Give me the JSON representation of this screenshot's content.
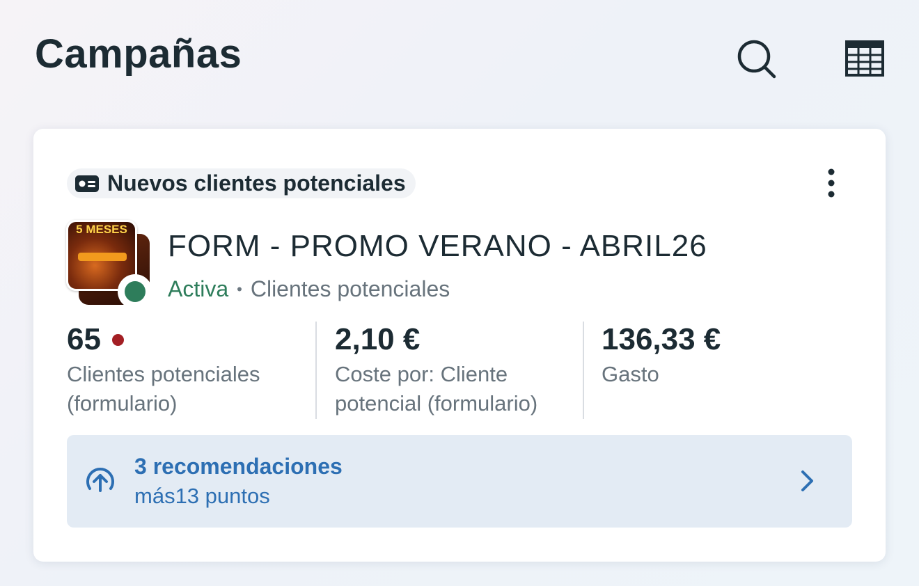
{
  "header": {
    "title": "Campañas",
    "search_icon": "search-icon",
    "table_icon": "table-view-icon"
  },
  "card": {
    "objective": {
      "icon": "lead-form-icon",
      "label": "Nuevos clientes potenciales"
    },
    "more_icon": "more-vertical-icon",
    "thumbnail": {
      "promo_text": "5 MESES",
      "status_color": "#2e7d5b"
    },
    "campaign_name": "FORM - PROMO VERANO - ABRIL26",
    "status": "Activa",
    "separator": "•",
    "type": "Clientes potenciales",
    "metrics": [
      {
        "value": "65",
        "label": "Clientes potenciales (formulario)",
        "alert": true,
        "alert_color": "#a31f24"
      },
      {
        "value": "2,10 €",
        "label": "Coste por: Cliente potencial (formulario)"
      },
      {
        "value": "136,33 €",
        "label": "Gasto"
      }
    ],
    "recommendations": {
      "icon": "arrow-up-circle-icon",
      "title": "3 recomendaciones",
      "subtitle": "más13 puntos",
      "chevron_icon": "chevron-right-icon",
      "accent_color": "#2d6fb3"
    }
  },
  "colors": {
    "text_primary": "#1c2b33",
    "text_secondary": "#67737c",
    "active_green": "#2e7d5b",
    "reco_background": "#e3ebf4"
  }
}
